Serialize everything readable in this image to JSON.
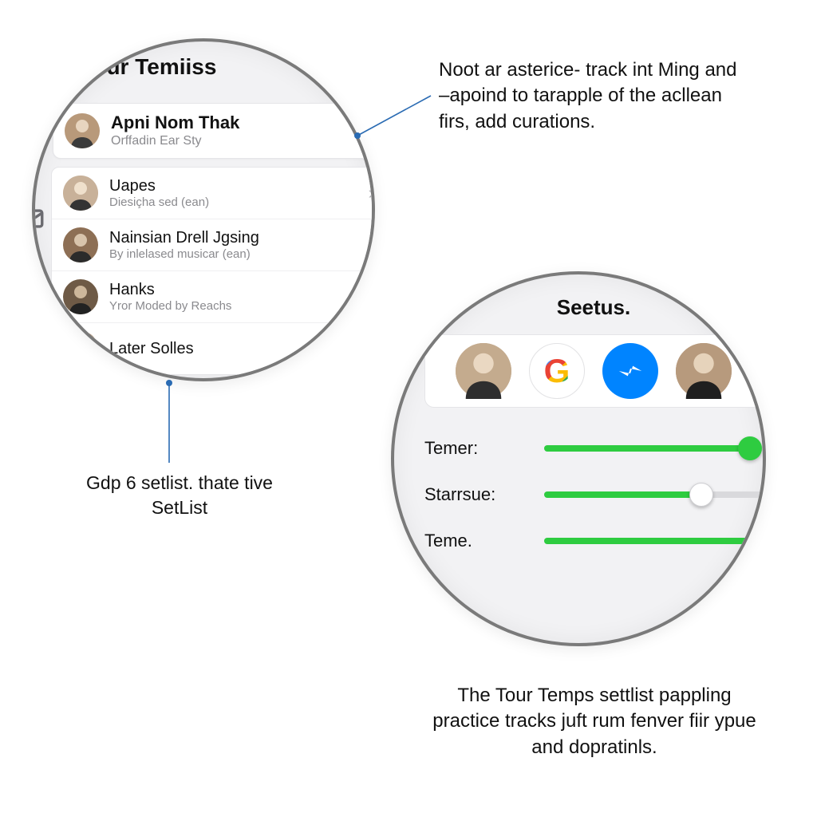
{
  "magnifier1": {
    "title": "Tour Temiiss",
    "card": {
      "title": "Apni Nom Thak",
      "subtitle": "Orffadin Ear Sty"
    },
    "rows": [
      {
        "title": "Uapes",
        "subtitle": "Diesiçha sed (ean)",
        "chev": true
      },
      {
        "title": "Nainsian Drell Jgsing",
        "subtitle": "By inlelased musicar (ean)"
      },
      {
        "title": "Hanks",
        "subtitle": "Yror Moded by Reachs"
      },
      {
        "title": "Later Solles",
        "subtitle": ""
      }
    ]
  },
  "magnifier2": {
    "title": "Seetus.",
    "icons": {
      "google_letter": "G"
    },
    "sliders": [
      {
        "label": "Temer:",
        "fill_pct": 94,
        "thumb_pct": 94,
        "thumb_color": "#2ecc40"
      },
      {
        "label": "Starrsue:",
        "fill_pct": 72,
        "thumb_pct": 72,
        "thumb_color": "#ffffff"
      },
      {
        "label": "Teme.",
        "fill_pct": 100,
        "thumb_pct": 100,
        "thumb_color": "none"
      }
    ]
  },
  "callouts": {
    "top_right": "Noot ar asterice- track int Ming and –apoind to tarapple of the acllean firs, add curations.",
    "left_mid": "Gdp 6 setlist. thate tive SetList",
    "bottom": "The Tour Temps settlist pappling practice tracks juft rum fenver fiir ypue and dopratinls."
  }
}
